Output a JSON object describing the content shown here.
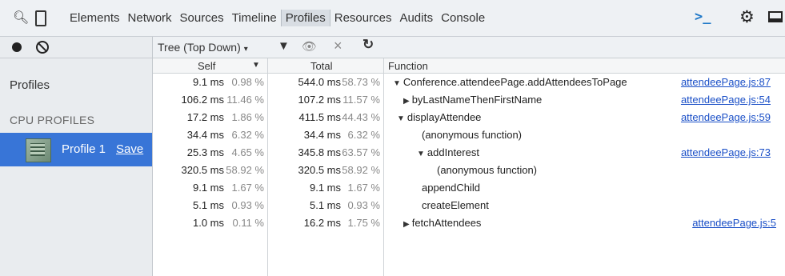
{
  "toolbar": {
    "tabs": [
      "Elements",
      "Network",
      "Sources",
      "Timeline",
      "Profiles",
      "Resources",
      "Audits",
      "Console"
    ],
    "active_tab": "Profiles",
    "console_glyph": ">_"
  },
  "sidebar": {
    "title": "Profiles",
    "section": "CPU PROFILES",
    "profile_name": "Profile 1",
    "profile_save": "Save"
  },
  "main": {
    "view_mode": "Tree (Top Down)",
    "columns": {
      "self": "Self",
      "total": "Total",
      "function": "Function"
    },
    "rows": [
      {
        "self_ms": "9.1 ms",
        "self_pct": "0.98 %",
        "total_ms": "544.0 ms",
        "total_pct": "58.73 %",
        "toggle": "▼",
        "fn": "Conference.attendeePage.addAttendeesToPage",
        "url": "attendeePage.js:87"
      },
      {
        "self_ms": "106.2 ms",
        "self_pct": "11.46 %",
        "total_ms": "107.2 ms",
        "total_pct": "11.57 %",
        "toggle": "▶",
        "fn": "byLastNameThenFirstName",
        "url": "attendeePage.js:54"
      },
      {
        "self_ms": "17.2 ms",
        "self_pct": "1.86 %",
        "total_ms": "411.5 ms",
        "total_pct": "44.43 %",
        "toggle": "▼",
        "fn": "displayAttendee",
        "url": "attendeePage.js:59"
      },
      {
        "self_ms": "34.4 ms",
        "self_pct": "6.32 %",
        "total_ms": "34.4 ms",
        "total_pct": "6.32 %",
        "toggle": "",
        "fn": "(anonymous function)",
        "url": ""
      },
      {
        "self_ms": "25.3 ms",
        "self_pct": "4.65 %",
        "total_ms": "345.8 ms",
        "total_pct": "63.57 %",
        "toggle": "▼",
        "fn": "addInterest",
        "url": "attendeePage.js:73"
      },
      {
        "self_ms": "320.5 ms",
        "self_pct": "58.92 %",
        "total_ms": "320.5 ms",
        "total_pct": "58.92 %",
        "toggle": "",
        "fn": "(anonymous function)",
        "url": ""
      },
      {
        "self_ms": "9.1 ms",
        "self_pct": "1.67 %",
        "total_ms": "9.1 ms",
        "total_pct": "1.67 %",
        "toggle": "",
        "fn": "appendChild",
        "url": ""
      },
      {
        "self_ms": "5.1 ms",
        "self_pct": "0.93 %",
        "total_ms": "5.1 ms",
        "total_pct": "0.93 %",
        "toggle": "",
        "fn": "createElement",
        "url": ""
      },
      {
        "self_ms": "1.0 ms",
        "self_pct": "0.11 %",
        "total_ms": "16.2 ms",
        "total_pct": "1.75 %",
        "toggle": "▶",
        "fn": "fetchAttendees",
        "url": "attendeePage.js:5"
      }
    ]
  },
  "colors": {
    "selection": "#3875d7",
    "link": "#1a4fc7",
    "toolbar_bg": "#eef1f4"
  }
}
